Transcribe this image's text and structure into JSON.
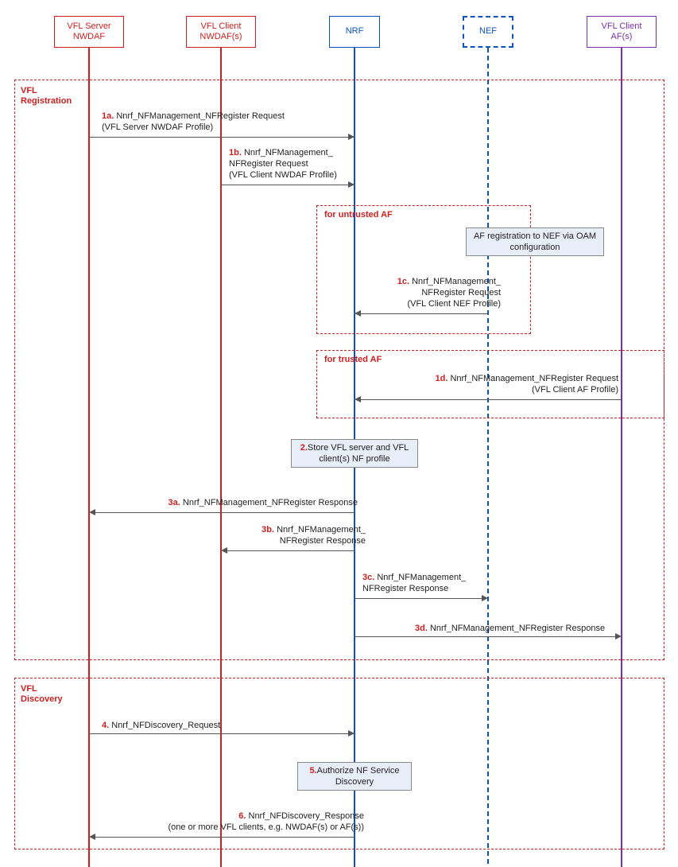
{
  "participants": {
    "vfl_server": "VFL Server\nNWDAF",
    "vfl_client_nwdaf": "VFL Client\nNWDAF(s)",
    "nrf": "NRF",
    "nef": "NEF",
    "vfl_client_af": "VFL Client\nAF(s)"
  },
  "phases": {
    "registration": "VFL\nRegistration",
    "discovery": "VFL\nDiscovery"
  },
  "alt": {
    "untrusted": "for untrusted AF",
    "trusted": "for trusted AF"
  },
  "notes": {
    "af_reg": "AF registration to NEF via OAM configuration",
    "store": "Store VFL server and VFL client(s) NF profile",
    "authorize": "Authorize NF Service Discovery"
  },
  "messages": {
    "m1a_num": "1a.",
    "m1a_txt": " Nnrf_NFManagement_NFRegister Request\n(VFL Server NWDAF Profile)",
    "m1b_num": "1b.",
    "m1b_txt": " Nnrf_NFManagement_\nNFRegister Request\n(VFL Client NWDAF Profile)",
    "m1c_num": "1c.",
    "m1c_txt": " Nnrf_NFManagement_\nNFRegister Request\n(VFL Client NEF Profile)",
    "m1d_num": "1d.",
    "m1d_txt": " Nnrf_NFManagement_NFRegister Request\n(VFL Client AF Profile)",
    "m2_num": "2.",
    "m2_txt": " ",
    "m3a_num": "3a.",
    "m3a_txt": " Nnrf_NFManagement_NFRegister Response",
    "m3b_num": "3b.",
    "m3b_txt": " Nnrf_NFManagement_\nNFRegister Response",
    "m3c_num": "3c.",
    "m3c_txt": " Nnrf_NFManagement_\nNFRegister Response",
    "m3d_num": "3d.",
    "m3d_txt": " Nnrf_NFManagement_NFRegister Response",
    "m4_num": "4.",
    "m4_txt": " Nnrf_NFDiscovery_Request",
    "m5_num": "5.",
    "m5_txt": " ",
    "m6_num": "6.",
    "m6_txt": " Nnrf_NFDiscovery_Response\n(one or more VFL clients, e.g. NWDAF(s) or AF(s))"
  }
}
